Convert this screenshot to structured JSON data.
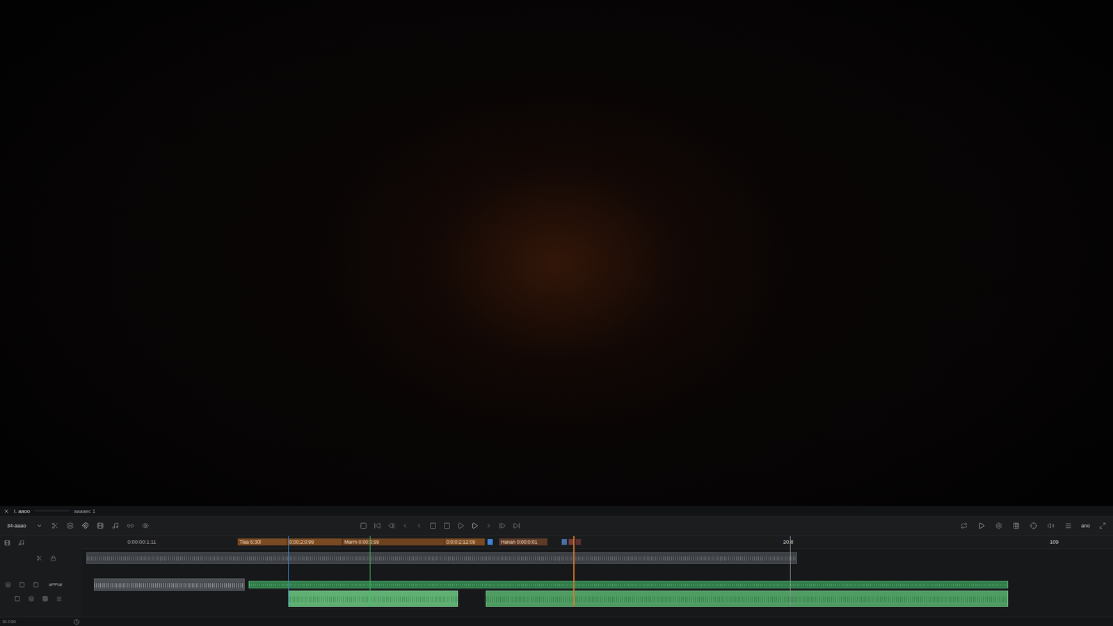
{
  "panel": {
    "title": "I. aaoo",
    "subtitle": "aaaaec 1"
  },
  "toolbar": {
    "preset": "34-aaao",
    "right_label": "ano"
  },
  "timeline": {
    "current_time": "0:00:00:1:11",
    "markers": [
      {
        "label": "Tiaa 6:30l",
        "color": "#7a4a22"
      },
      {
        "label": "0:00:2:0:99",
        "color": "#7a4a22"
      },
      {
        "label": "Marrn 0:00:0:99",
        "color": "#6e4220"
      },
      {
        "label": "0:0:0:2:12:09",
        "color": "#7a4a22"
      },
      {
        "label": "Hanan 0:00:0:01",
        "color": "#5e3b28"
      }
    ],
    "flags": [
      {
        "color": "#3d86d8"
      },
      {
        "color": "#4a6fa8"
      },
      {
        "color": "#7a3a3a"
      },
      {
        "color": "#5a3030"
      }
    ],
    "ruler": [
      "20.8",
      "109"
    ],
    "track_label": "aPPlal"
  },
  "footer": {
    "label": "SI.030"
  }
}
